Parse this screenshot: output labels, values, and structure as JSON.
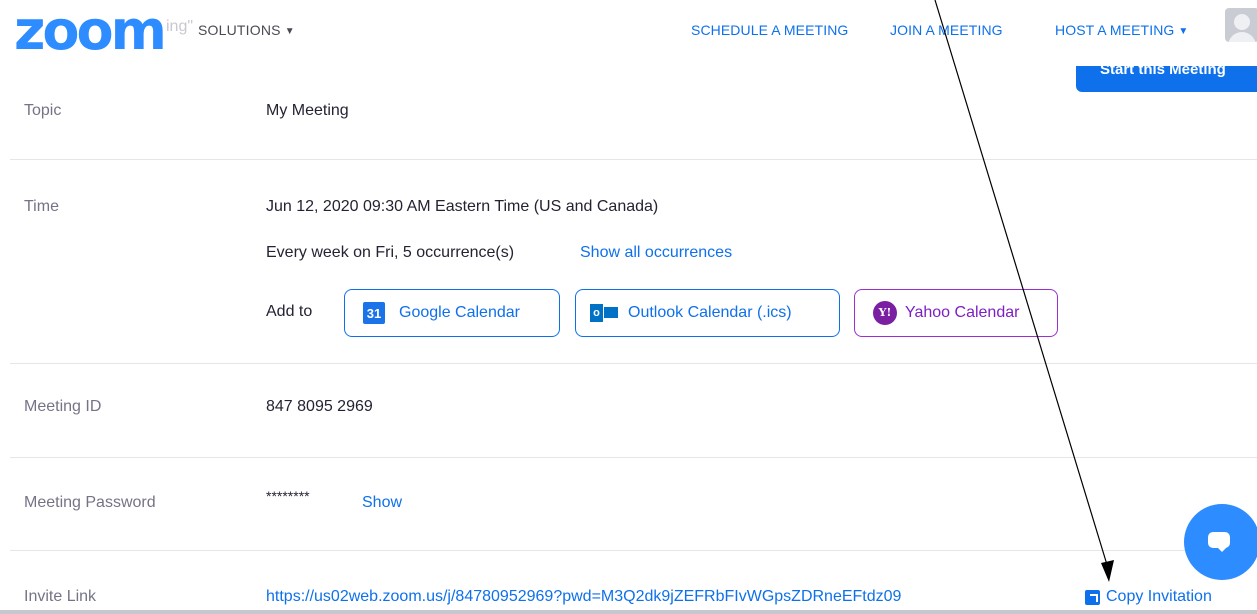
{
  "nav": {
    "logo": "zoom",
    "page_title_faded": "ing\"",
    "solutions": "SOLUTIONS",
    "schedule": "SCHEDULE A MEETING",
    "join": "JOIN A MEETING",
    "host": "HOST A MEETING",
    "start_button": "Start this Meeting"
  },
  "topic": {
    "label": "Topic",
    "value": "My Meeting"
  },
  "time": {
    "label": "Time",
    "value": "Jun 12, 2020 09:30 AM Eastern Time (US and Canada)",
    "recurrence": "Every week on Fri, 5 occurrence(s)",
    "show_all": "Show all occurrences",
    "add_to": "Add to",
    "google": "Google Calendar",
    "google_icon_text": "31",
    "outlook": "Outlook Calendar (.ics)",
    "outlook_icon_text": "o",
    "yahoo": "Yahoo Calendar",
    "yahoo_icon_text": "Y!"
  },
  "meeting_id": {
    "label": "Meeting ID",
    "value": "847 8095 2969"
  },
  "password": {
    "label": "Meeting Password",
    "value": "********",
    "show": "Show"
  },
  "invite": {
    "label": "Invite Link",
    "url": "https://us02web.zoom.us/j/84780952969?pwd=M3Q2dk9jZEFRbFIvWGpsZDRneEFtdz09",
    "copy": "Copy Invitation"
  },
  "colors": {
    "accent": "#0E71EB",
    "brand": "#2D8CFF",
    "yahoo": "#7e1fc2"
  }
}
